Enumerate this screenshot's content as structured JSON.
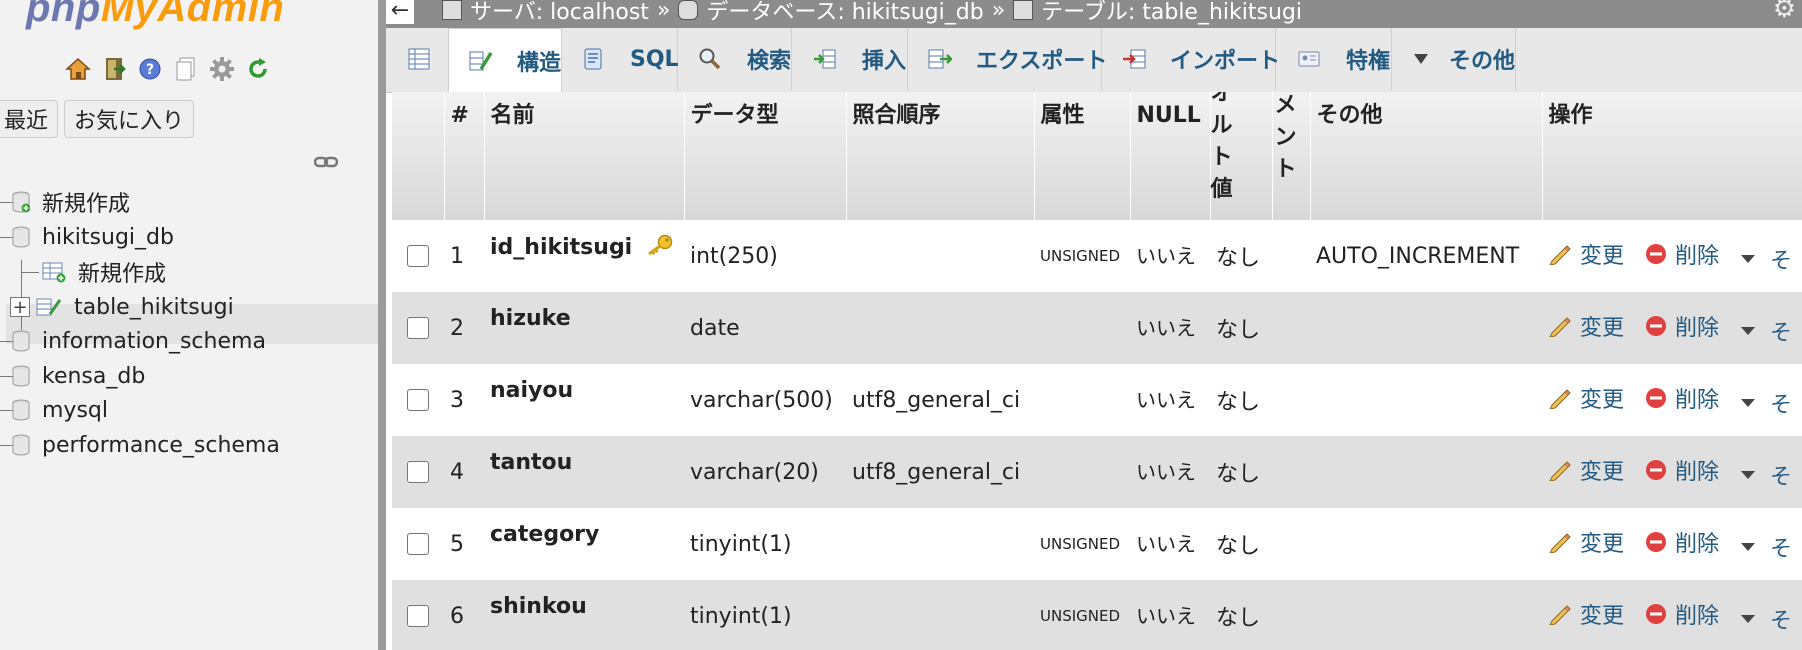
{
  "nav": {
    "logo_php": "php",
    "logo_myadmin": "MyAdmin",
    "icons": [
      "home-icon",
      "exit-icon",
      "help-icon",
      "docs-icon",
      "settings-icon",
      "reload-icon"
    ],
    "tabs": [
      "最近",
      "お気に入り"
    ],
    "tree": [
      {
        "label": "新規作成"
      },
      {
        "label": "hikitsugi_db"
      },
      {
        "label": "新規作成"
      },
      {
        "label": "table_hikitsugi"
      },
      {
        "label": "information_schema"
      },
      {
        "label": "kensa_db"
      },
      {
        "label": "mysql"
      },
      {
        "label": "performance_schema"
      }
    ]
  },
  "breadcrumb": {
    "server_label": "サーバ: localhost",
    "sep1": "»",
    "db_label": "データベース: hikitsugi_db",
    "sep2": "»",
    "table_label": "テーブル: table_hikitsugi"
  },
  "tabs": [
    {
      "label": "表示"
    },
    {
      "label": "構造"
    },
    {
      "label": "SQL"
    },
    {
      "label": "検索"
    },
    {
      "label": "挿入"
    },
    {
      "label": "エクスポート"
    },
    {
      "label": "インポート"
    },
    {
      "label": "特権"
    },
    {
      "label": "その他"
    }
  ],
  "table": {
    "headers": {
      "num": "#",
      "name": "名前",
      "type": "データ型",
      "collation": "照合順序",
      "attributes": "属性",
      "null": "NULL",
      "default": "オルト値",
      "comment": "メント",
      "extra": "その他",
      "action": "操作"
    },
    "rows": [
      {
        "num": "1",
        "name": "id_hikitsugi",
        "type": "int(250)",
        "collation": "",
        "attr": "UNSIGNED",
        "null": "いいえ",
        "default": "なし",
        "extra": "AUTO_INCREMENT",
        "primary": true
      },
      {
        "num": "2",
        "name": "hizuke",
        "type": "date",
        "collation": "",
        "attr": "",
        "null": "いいえ",
        "default": "なし",
        "extra": ""
      },
      {
        "num": "3",
        "name": "naiyou",
        "type": "varchar(500)",
        "collation": "utf8_general_ci",
        "attr": "",
        "null": "いいえ",
        "default": "なし",
        "extra": ""
      },
      {
        "num": "4",
        "name": "tantou",
        "type": "varchar(20)",
        "collation": "utf8_general_ci",
        "attr": "",
        "null": "いいえ",
        "default": "なし",
        "extra": ""
      },
      {
        "num": "5",
        "name": "category",
        "type": "tinyint(1)",
        "collation": "",
        "attr": "UNSIGNED",
        "null": "いいえ",
        "default": "なし",
        "extra": ""
      },
      {
        "num": "6",
        "name": "shinkou",
        "type": "tinyint(1)",
        "collation": "",
        "attr": "UNSIGNED",
        "null": "いいえ",
        "default": "なし",
        "extra": ""
      }
    ],
    "actions": {
      "change": "変更",
      "drop": "削除",
      "more": "そ"
    }
  }
}
